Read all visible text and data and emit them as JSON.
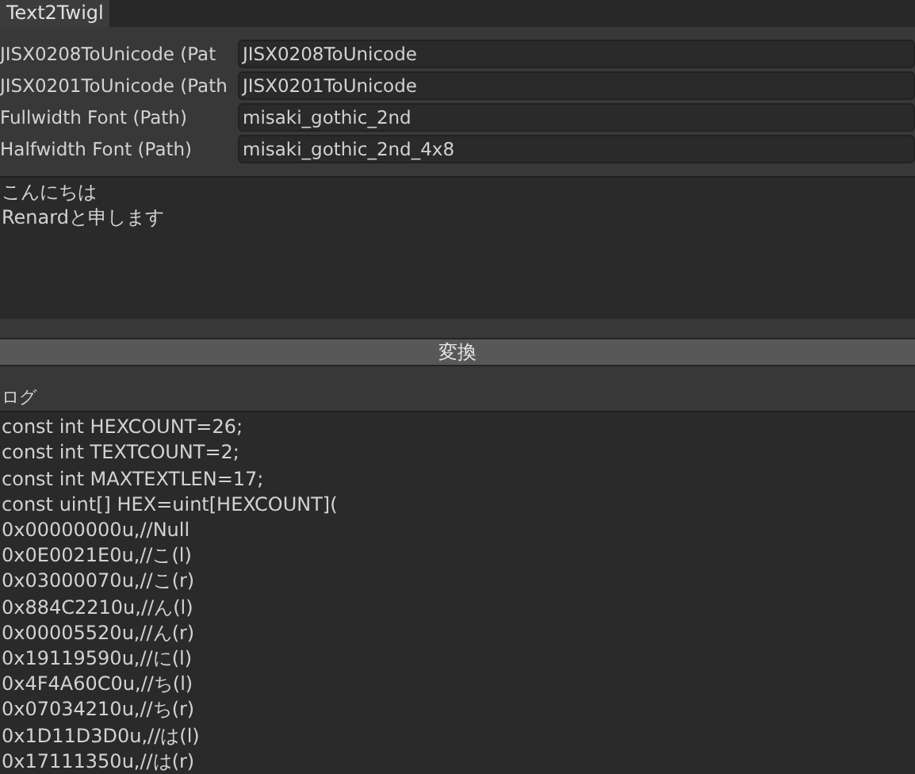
{
  "tab": {
    "label": "Text2Twigl",
    "selected": true
  },
  "fields": [
    {
      "label": "JISX0208ToUnicode (Pat",
      "value": "JISX0208ToUnicode"
    },
    {
      "label": "JISX0201ToUnicode (Path",
      "value": "JISX0201ToUnicode"
    },
    {
      "label": "Fullwidth Font (Path)",
      "value": "misaki_gothic_2nd"
    },
    {
      "label": "Halfwidth Font (Path)",
      "value": "misaki_gothic_2nd_4x8"
    }
  ],
  "input_text": [
    "こんにちは",
    "Renardと申します"
  ],
  "convert_button": "変換",
  "log_label": "ログ",
  "log_lines": [
    "const int HEXCOUNT=26;",
    "const int TEXTCOUNT=2;",
    "const int MAXTEXTLEN=17;",
    "const uint[] HEX=uint[HEXCOUNT](",
    "0x00000000u,//Null",
    "0x0E0021E0u,//こ(l)",
    "0x03000070u,//こ(r)",
    "0x884C2210u,//ん(l)",
    "0x00005520u,//ん(r)",
    "0x19119590u,//に(l)",
    "0x4F4A60C0u,//ち(l)",
    "0x07034210u,//ち(r)",
    "0x1D11D3D0u,//は(l)",
    "0x17111350u,//は(r)"
  ]
}
